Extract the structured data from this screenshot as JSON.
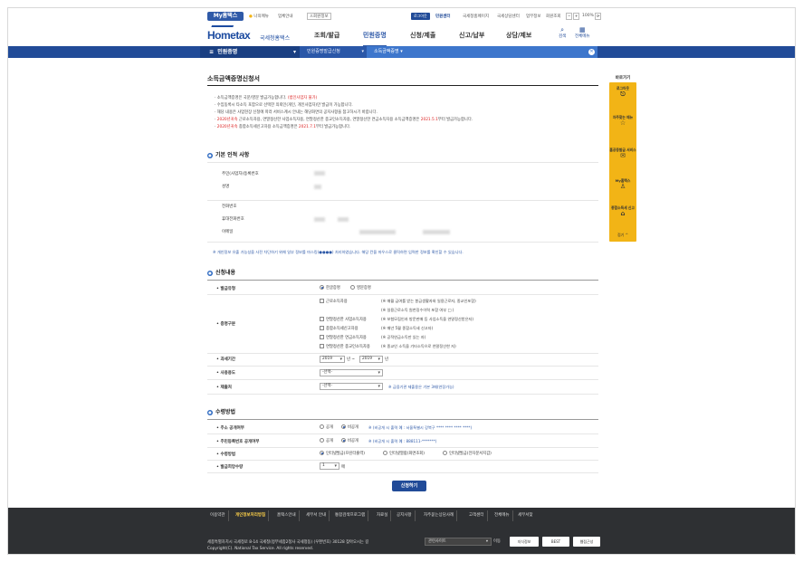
{
  "header": {
    "brand": "My홈택스",
    "top_links": {
      "guide": "나의메뉴",
      "simple_guide": "업체안내",
      "signup": "회원정보"
    },
    "logout": "로그아웃",
    "links": [
      "민원센터",
      "국세청홈페이지",
      "국세상담센터",
      "업무정보",
      "회원조회"
    ],
    "zoom": "100%",
    "logo_main": "Hometax",
    "logo_sub": "국세청홈택스",
    "gnb": [
      "조회/발급",
      "민원증명",
      "신청/제출",
      "신고/납부",
      "상담/제보"
    ],
    "gnb_active_index": 1,
    "utils": {
      "search": "검색",
      "all_menu": "전체메뉴"
    }
  },
  "navbar": {
    "menu": "민원증명",
    "crumb1": "민원증명발급신청",
    "crumb2": "소득금액증명"
  },
  "page": {
    "title": "소득금액증명신청서",
    "notices": [
      {
        "text": "소득금액증명은 국문/영문 발급가능합니다.",
        "red": "(법인사업자 불가)"
      },
      {
        "text": "수임동록시 타소득 포함으로 선택한 의뢰인(개인, 개인사업자)만 발급이 가능합니다.",
        "red": ""
      },
      {
        "text": "해당 내용은 사업현장 신청에 따라 서비스계시 안내는 해당화면의 공지사항을 참고하시기 바랍니다.",
        "red": ""
      },
      {
        "prefix": "2020년귀속",
        "text": "근로소득자용, 연말정산한 사업소득자용, 연말정산한 종교인소득자용, 연말정산한 연금소득자용 소득금액증명은 ",
        "date": "2021.5.1",
        "suffix": "부터 발급가능합니다."
      },
      {
        "prefix": "2020년귀속",
        "text": "종합소득세신고자용 소득금액증명은 ",
        "date": "2021.7.1",
        "suffix": "부터 발급가능합니다."
      }
    ],
    "basic_section": "기본 인적 사항",
    "basic_fields": [
      "주민(사업자)등록번호",
      "성명",
      "전화번호",
      "휴대전화번호",
      "이메일"
    ],
    "privacy_note": "※ 개인정보 유출 가능성을 사전 차단하기 위해 일부 정보를 마스킹(●●●●) 처리하였습니다. 해당 칸을 마우스로 클릭하면 입력한 정보를 확인할 수 있습니다.",
    "apply_section": "신청내용",
    "issue_type_label": "발급유형",
    "issue_type_options": [
      "한글증명",
      "영문증명"
    ],
    "issue_type_selected": 0,
    "cert_type_label": "증명구분",
    "cert_options": [
      {
        "label": "근로소득자용",
        "hint": "(※ 매월 급여를 받는 봉급생활자와 일용근로자, 종교인포함)"
      },
      {
        "label": "",
        "hint": "(※ 일용근로소득 원천징수이력 포함 여부 □ )"
      },
      {
        "label": "연말정산한 사업소득자용",
        "hint": "(※ 보험모집인과 방문판매 등 사업소득을 연말정산받은자)"
      },
      {
        "label": "종합소득세신고자용",
        "hint": "(※ 매년 5월 종합소득세 신고자)"
      },
      {
        "label": "연말정산한 연금소득자용",
        "hint": "(※ 공적연금소득만 있는 자)"
      },
      {
        "label": "연말정산한 종교인소득자용",
        "hint": "(※ 종교인 소득을 기타소득으로 연말정산한 자)"
      }
    ],
    "period_label": "과세기간",
    "period_from": "2019",
    "period_to": "2019",
    "period_year1": "년 ~",
    "period_year2": "년",
    "usage_label": "사용용도",
    "usage_value": "-선택-",
    "submit_label": "제출처",
    "submit_value": "-선택-",
    "submit_hint": "※ 금융기관 제출용은 기본 3매(연장가능)",
    "receive_section": "수령방법",
    "address_label": "주소 공개여부",
    "address_options": [
      "공개",
      "비공개"
    ],
    "address_hint": "※ (비공개 시 출력 예 : 서울특별시 강북구 **** **** **** ****)",
    "rrn_label": "주민등록번호 공개여부",
    "rrn_options": [
      "공개",
      "비공개"
    ],
    "rrn_hint": "※ (비공개 시 출력 예 : 888111-*******)",
    "receive_label": "수령방법",
    "receive_options": [
      "인터넷발급(프린터출력)",
      "인터넷열람(화면조회)",
      "인터넷발급(전자문서지갑)"
    ],
    "copies_label": "발급희망수량",
    "copies_value": "1",
    "copies_unit": "매",
    "apply_button": "신청하기"
  },
  "quick": {
    "title": "바로가기",
    "items": [
      "로그아웃",
      "자주찾는 메뉴",
      "홈공증발급 서비스",
      "My홈택스",
      "종합소득세 신고"
    ],
    "close": "접기 ^"
  },
  "footer": {
    "nav": [
      "이용약관",
      "개인정보처리방침",
      "홈택스안내",
      "세무서 안내",
      "통합검색프로그램",
      "자료실",
      "공지사항",
      "자주묻는상담사례",
      "고객센터",
      "전체메뉴",
      "세무서찾"
    ],
    "address": "세종특별자치시 국세청로 8-14 국세청(정부세종2청사 국세청동) (우편번호) 30128   찾아오시는 길",
    "copyright": "Copyright(C). National Tax Service. All rights reserved.",
    "family_select": "관련사이트",
    "move": "이동",
    "logos": [
      "지식정보",
      "BEST",
      "웹접근성"
    ]
  },
  "colors": {
    "primary": "#214b98",
    "accent": "#3d76cc",
    "quick": "#f2b416",
    "notice_red": "#dd2222"
  }
}
